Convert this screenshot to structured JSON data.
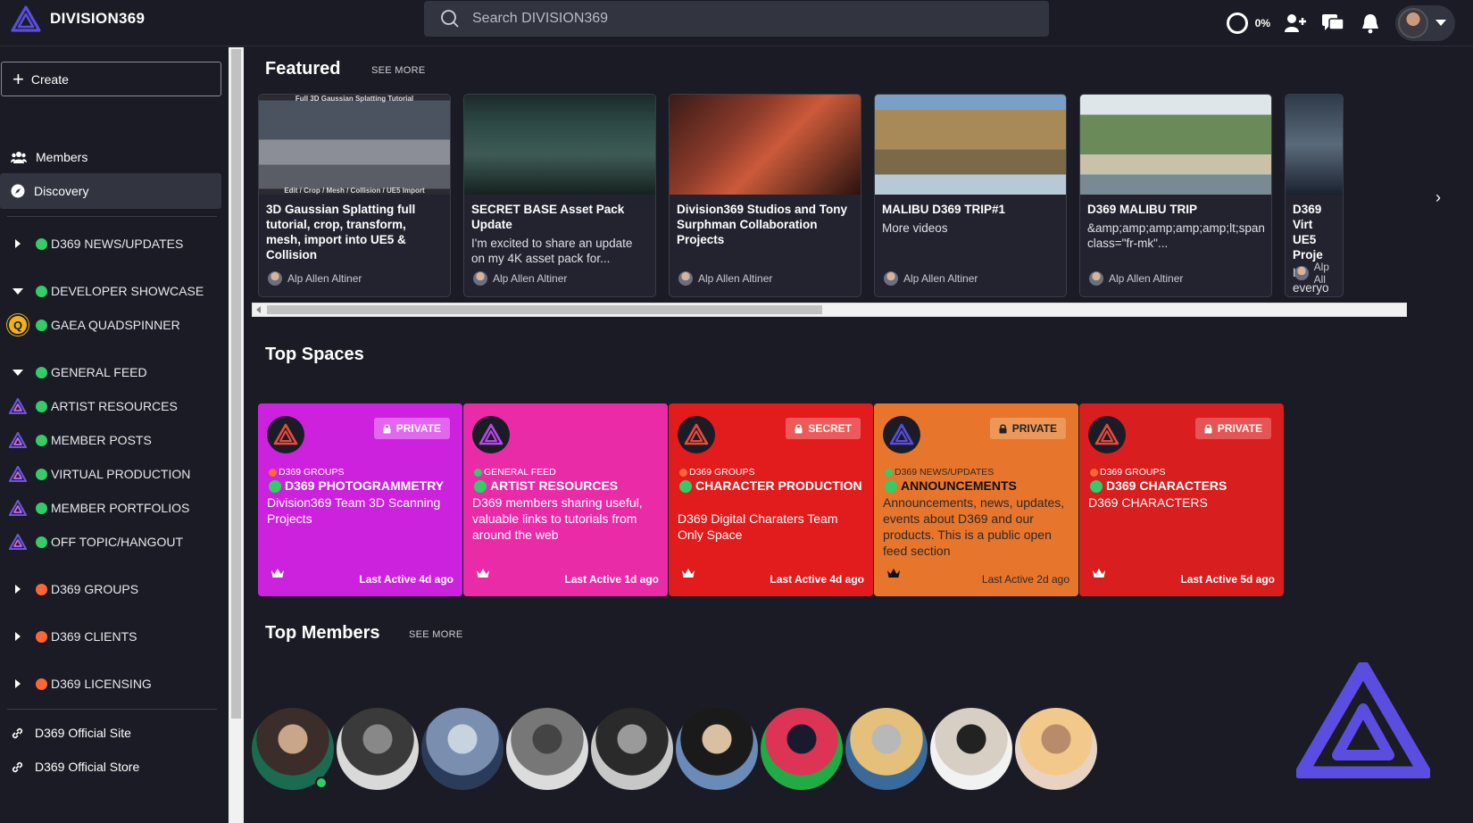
{
  "brand": {
    "name": "DIVISION369"
  },
  "search": {
    "placeholder": "Search DIVISION369"
  },
  "topbar": {
    "progress_label": "0%"
  },
  "sidebar": {
    "create_label": "Create",
    "nav": [
      {
        "label": "Members",
        "icon": "members-icon"
      },
      {
        "label": "Discovery",
        "icon": "compass-icon"
      }
    ],
    "groups": [
      {
        "label": "D369 NEWS/UPDATES",
        "dot": "#33cc66",
        "lead": "expand-right"
      },
      {
        "label": "DEVELOPER SHOWCASE",
        "dot": "#33cc66",
        "lead": "expand-down"
      },
      {
        "label": "GAEA QUADSPINNER",
        "dot": "#33cc66",
        "lead": "q-badge",
        "badge": "Q"
      },
      {
        "label": "GENERAL FEED",
        "dot": "#33cc66",
        "lead": "expand-down"
      },
      {
        "label": "ARTIST RESOURCES",
        "dot": "#33cc66",
        "lead": "triangle-logo"
      },
      {
        "label": "MEMBER POSTS",
        "dot": "#33cc66",
        "lead": "triangle-logo"
      },
      {
        "label": "VIRTUAL PRODUCTION",
        "dot": "#33cc66",
        "lead": "triangle-logo"
      },
      {
        "label": "MEMBER PORTFOLIOS",
        "dot": "#33cc66",
        "lead": "triangle-logo"
      },
      {
        "label": "OFF TOPIC/HANGOUT",
        "dot": "#33cc66",
        "lead": "triangle-logo"
      },
      {
        "label": "D369 GROUPS",
        "dot": "#ff6633",
        "lead": "expand-right"
      },
      {
        "label": "D369 CLIENTS",
        "dot": "#ff6633",
        "lead": "expand-right"
      },
      {
        "label": "D369 LICENSING",
        "dot": "#ff6633",
        "lead": "expand-right"
      }
    ],
    "links": [
      {
        "label": "D369 Official Site",
        "icon": "link-icon"
      },
      {
        "label": "D369 Official Store",
        "icon": "link-icon"
      }
    ]
  },
  "featured": {
    "title": "Featured",
    "see_more": "SEE MORE",
    "cards": [
      {
        "title": "3D Gaussian Splatting full tutorial, crop, transform, mesh, import into UE5 & Collision",
        "desc": "",
        "author": "Alp Allen Altiner",
        "thumb_top": "Full 3D Gaussian Splatting Tutorial",
        "thumb_bottom": "Edit / Crop / Mesh / Collision / UE5 Import"
      },
      {
        "title": "SECRET BASE Asset Pack Update",
        "desc": "I'm excited to share an update on my 4K asset pack for...",
        "author": "Alp Allen Altiner"
      },
      {
        "title": "Division369 Studios and Tony Surphman Collaboration Projects",
        "desc": "",
        "author": "Alp Allen Altiner"
      },
      {
        "title": "MALIBU D369 TRIP#1",
        "desc": "More videos",
        "author": "Alp Allen Altiner"
      },
      {
        "title": "D369 MALIBU TRIP",
        "desc": "&amp;amp;amp;amp;amp;lt;span class=\"fr-mk\"...",
        "author": "Alp Allen Altiner"
      },
      {
        "title": "D369 Virt UE5 Proje",
        "desc": "Hi everyo",
        "author": "Alp All"
      }
    ]
  },
  "spaces": {
    "title": "Top Spaces",
    "cards": [
      {
        "badge": "PRIVATE",
        "category": "D369 GROUPS",
        "cat_dot": "#ff6633",
        "name": "D369 PHOTOGRAMMETRY",
        "desc": "Division369 Team 3D Scanning Projects",
        "active": "Last Active 4d ago",
        "bg": "#cc22dd",
        "badge_bg": "#e266f0",
        "logo_color": "#e84a3c"
      },
      {
        "badge": "",
        "category": "GENERAL FEED",
        "cat_dot": "#33cc66",
        "name": "ARTIST RESOURCES",
        "desc": "D369 members sharing useful, valuable links to tutorials from around the web",
        "active": "Last Active 1d ago",
        "bg": "#ea2ba8",
        "badge_bg": "",
        "logo_color": "#b64ae8"
      },
      {
        "badge": "SECRET",
        "category": "D369 GROUPS",
        "cat_dot": "#ff6633",
        "name": "CHARACTER PRODUCTION",
        "desc": "D369 Digital Charaters Team Only Space",
        "active": "Last Active 4d ago",
        "bg": "#e21c1c",
        "badge_bg": "#ee5a5a",
        "logo_color": "#e84a3c"
      },
      {
        "badge": "PRIVATE",
        "category": "D369 NEWS/UPDATES",
        "cat_dot": "#33cc66",
        "name": "ANNOUNCEMENTS",
        "desc": "Announcements, news, updates, events about D369 and our products. This is a public open feed section",
        "active": "Last Active 2d ago",
        "bg": "#e8752c",
        "badge_bg": "#ed9858",
        "logo_color": "#5b4de0",
        "dark_text": true
      },
      {
        "badge": "PRIVATE",
        "category": "D369 GROUPS",
        "cat_dot": "#ff6633",
        "name": "D369 CHARACTERS",
        "desc": "D369 CHARACTERS",
        "active": "Last Active 5d ago",
        "bg": "#d81e1e",
        "badge_bg": "#e65555",
        "logo_color": "#e84a3c"
      }
    ]
  },
  "members": {
    "title": "Top Members",
    "see_more": "SEE MORE",
    "avatars": [
      {
        "name": "member-avatar-1",
        "colors": [
          "#1a6b4f",
          "#3b2e2a",
          "#c9a58a"
        ]
      },
      {
        "name": "member-avatar-2",
        "colors": [
          "#d9d9d9",
          "#3a3a3a",
          "#888"
        ]
      },
      {
        "name": "member-avatar-3",
        "colors": [
          "#2a3c5a",
          "#7a8fb0",
          "#c8d3e0"
        ]
      },
      {
        "name": "member-avatar-4",
        "colors": [
          "#dcdcdc",
          "#777",
          "#444"
        ]
      },
      {
        "name": "member-avatar-5",
        "colors": [
          "#c7c7c7",
          "#2a2a2a",
          "#9a9a9a"
        ]
      },
      {
        "name": "member-avatar-6",
        "colors": [
          "#6a8ab8",
          "#1a1a1a",
          "#d9c0a0"
        ]
      },
      {
        "name": "member-avatar-7",
        "colors": [
          "#22aa44",
          "#dd3355",
          "#1a1a2e"
        ]
      },
      {
        "name": "member-avatar-8",
        "colors": [
          "#3a6a9a",
          "#e4c07a",
          "#b8b8b8"
        ]
      },
      {
        "name": "member-avatar-9",
        "colors": [
          "#f2f2f2",
          "#d8cfc4",
          "#222"
        ]
      },
      {
        "name": "member-avatar-10",
        "colors": [
          "#e8d3c3",
          "#f2c98a",
          "#b88b6a"
        ]
      }
    ]
  },
  "colors": {
    "accent": "#5b4de0",
    "bg": "#1a1b24",
    "surface": "#22232e",
    "online": "#33cc66"
  }
}
